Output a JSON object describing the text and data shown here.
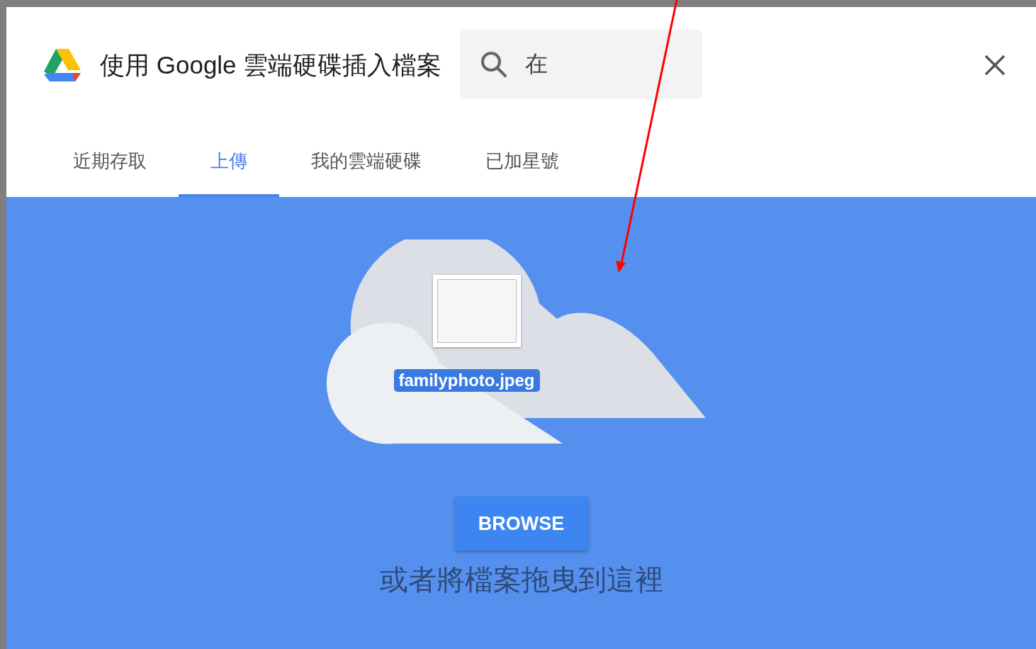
{
  "dialog": {
    "title": "使用 Google 雲端硬碟插入檔案",
    "search": {
      "value": "在"
    }
  },
  "tabs": [
    {
      "label": "近期存取",
      "selected": false
    },
    {
      "label": "上傳",
      "selected": true
    },
    {
      "label": "我的雲端硬碟",
      "selected": false
    },
    {
      "label": "已加星號",
      "selected": false
    }
  ],
  "upload": {
    "file_name": "familyphoto.jpeg",
    "button": "BROWSE",
    "hint": "或者將檔案拖曳到這裡"
  }
}
